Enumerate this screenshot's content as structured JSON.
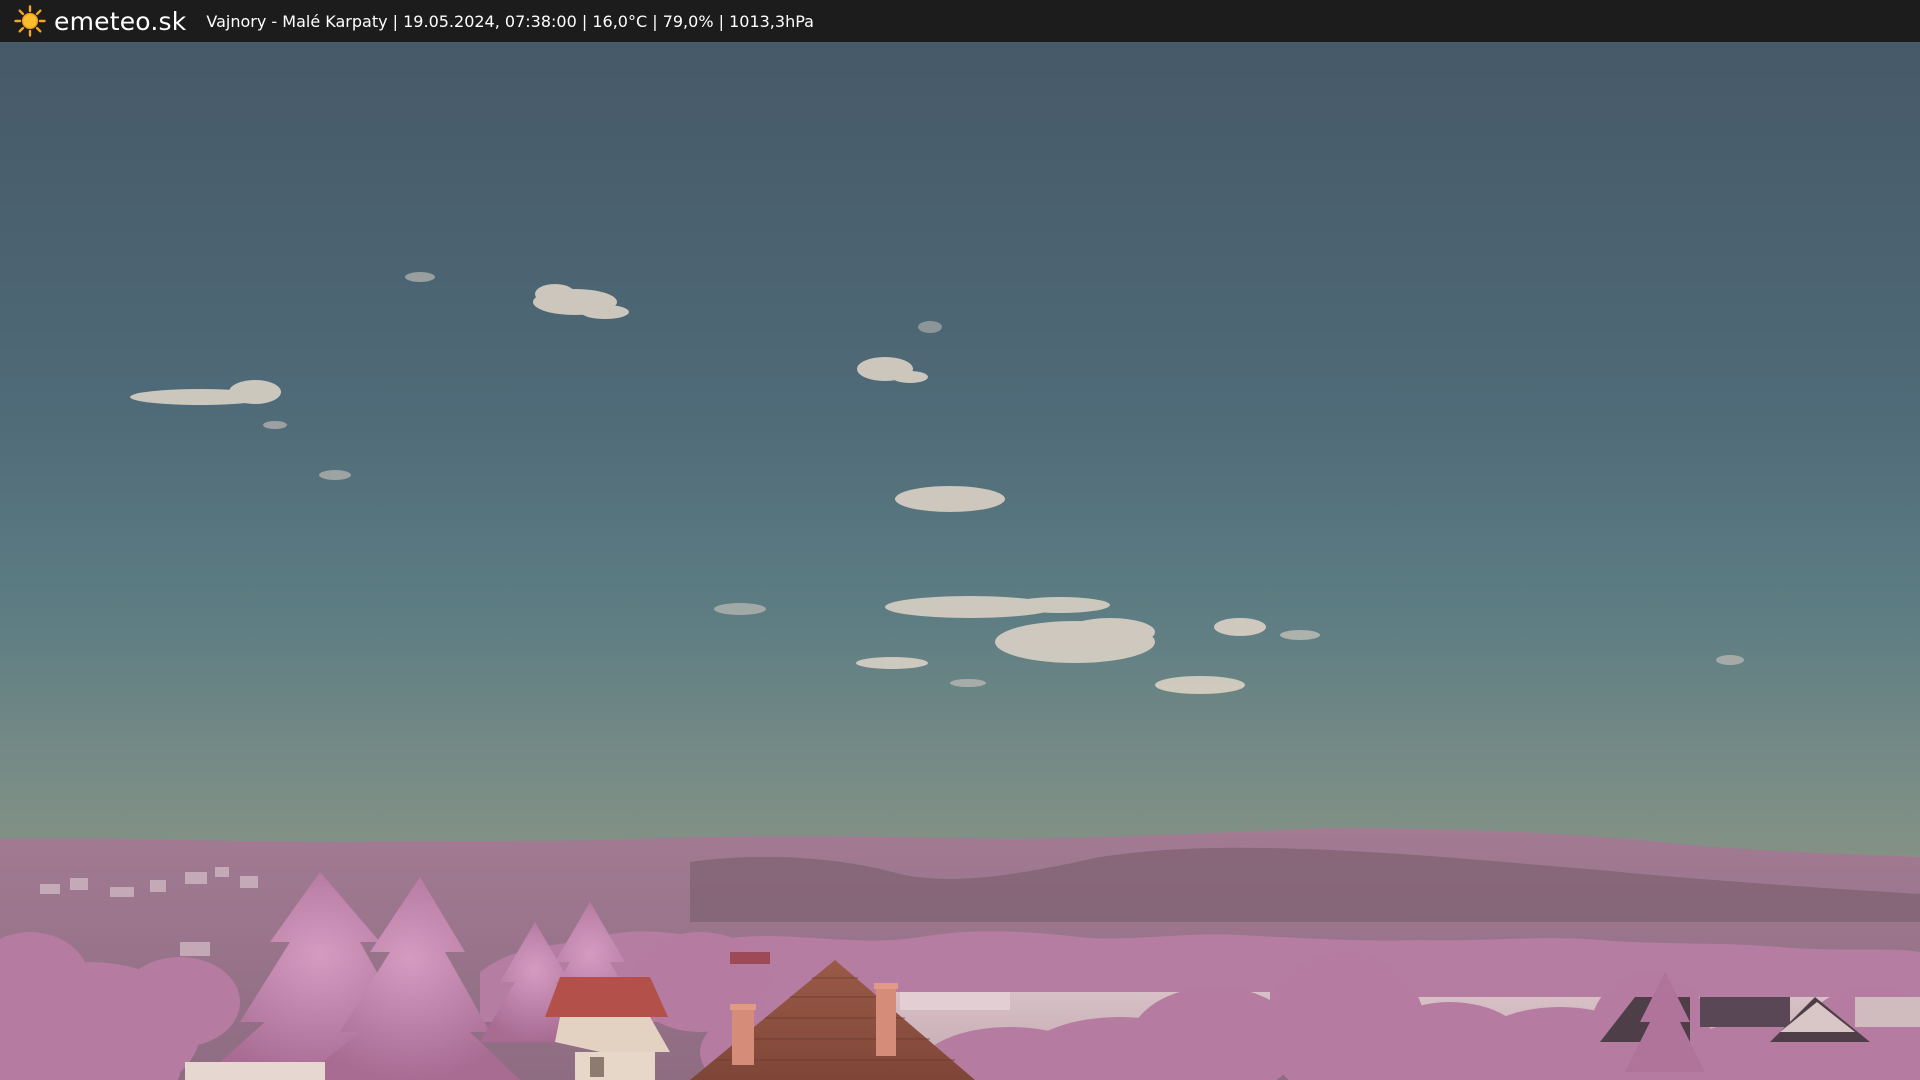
{
  "header": {
    "brand": "emeteo.sk",
    "caption": "Vajnory - Malé Karpaty | 19.05.2024, 07:38:00 | 16,0°C | 79,0% | 1013,3hPa",
    "logo_icon": "sun-icon"
  },
  "colors": {
    "bar": "#1c1c1c",
    "sky_top": "#465a6a",
    "sky_horizon": "#8f9584",
    "hills": "#a0788e",
    "foliage": "#c48ab0",
    "roof": "#b4524c"
  }
}
